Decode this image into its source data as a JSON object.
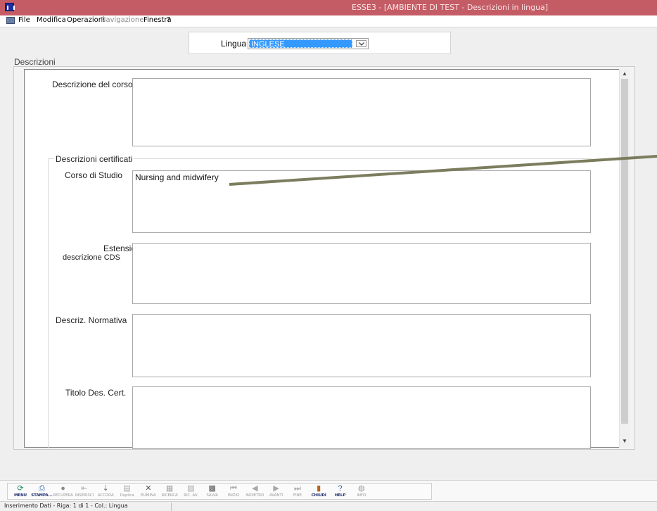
{
  "window": {
    "title": "ESSE3 - [AMBIENTE DI TEST - Descrizioni in lingua]"
  },
  "menu": [
    {
      "label": "File",
      "enabled": true
    },
    {
      "label": "Modifica",
      "enabled": true
    },
    {
      "label": "Operazioni",
      "enabled": true
    },
    {
      "label": "Navigazione",
      "enabled": false
    },
    {
      "label": "Finestra",
      "enabled": true
    },
    {
      "label": "?",
      "enabled": true
    }
  ],
  "lingua": {
    "label": "Lingua",
    "value": "INGLESE"
  },
  "descrizioni": {
    "group_label": "Descrizioni",
    "descrizione_corso": {
      "label": "Descrizione del corso",
      "value": ""
    },
    "certificati": {
      "group_label": "Descrizioni certificati",
      "corso_di_studio": {
        "label": "Corso di Studio",
        "value": "Nursing and midwifery"
      },
      "estensione_cds": {
        "label_line1": "Estensione",
        "label_line2": "descrizione CDS",
        "value": ""
      },
      "normativa": {
        "label": "Descriz. Normativa",
        "value": ""
      },
      "titolo": {
        "label": "Titolo Des. Cert.",
        "value": ""
      }
    }
  },
  "toolbar": [
    {
      "label": "MENU",
      "icon": "⟳",
      "color": "#1b8a5a",
      "enabled": true
    },
    {
      "label": "STAMPA...",
      "icon": "⎙",
      "color": "#3a6fb0",
      "enabled": true
    },
    {
      "label": "RECUPERA",
      "icon": "●",
      "color": "#8c8c8c",
      "enabled": false
    },
    {
      "label": "INSERISCI",
      "icon": "⇤",
      "color": "#a8a8a8",
      "enabled": false
    },
    {
      "label": "ACCODA",
      "icon": "⇣",
      "color": "#707070",
      "enabled": false
    },
    {
      "label": "Duplica",
      "icon": "▤",
      "color": "#a8a8a8",
      "enabled": false
    },
    {
      "label": "ELIMINA",
      "icon": "✕",
      "color": "#555555",
      "enabled": false
    },
    {
      "label": "RICERCA",
      "icon": "▦",
      "color": "#a8a8a8",
      "enabled": false
    },
    {
      "label": "RIC. AV.",
      "icon": "▧",
      "color": "#a8a8a8",
      "enabled": false
    },
    {
      "label": "SALVA",
      "icon": "▩",
      "color": "#555555",
      "enabled": false
    },
    {
      "label": "INIZIO",
      "icon": "⏮",
      "color": "#a8a8a8",
      "enabled": false
    },
    {
      "label": "INDIETRO",
      "icon": "◀",
      "color": "#a8a8a8",
      "enabled": false
    },
    {
      "label": "AVANTI",
      "icon": "▶",
      "color": "#a8a8a8",
      "enabled": false
    },
    {
      "label": "FINE",
      "icon": "⏭",
      "color": "#a8a8a8",
      "enabled": false
    },
    {
      "label": "CHIUDI",
      "icon": "▮",
      "color": "#b5651d",
      "enabled": true
    },
    {
      "label": "HELP",
      "icon": "?",
      "color": "#2a5db0",
      "enabled": true
    },
    {
      "label": "INFO",
      "icon": "◍",
      "color": "#9a9a9a",
      "enabled": false
    }
  ],
  "status": {
    "text": "Inserimento Dati - Riga: 1 di 1 - Col.: Lingua"
  }
}
